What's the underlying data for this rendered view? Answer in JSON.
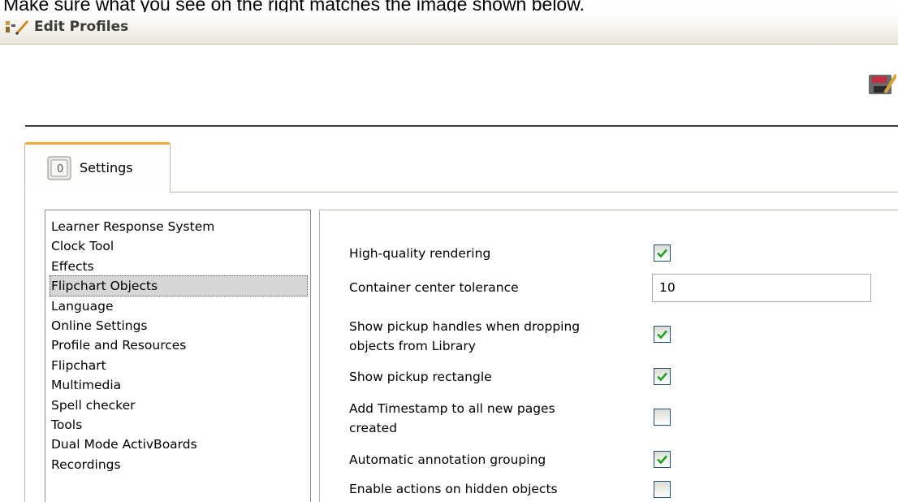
{
  "instruction": "Make sure what you see on the right matches the image shown below.",
  "window": {
    "title": "Edit Profiles"
  },
  "tabs": [
    {
      "label": "Settings"
    }
  ],
  "categories": [
    "Learner Response System",
    "Clock Tool",
    "Effects",
    "Flipchart Objects",
    "Language",
    "Online Settings",
    "Profile and Resources",
    "Flipchart",
    "Multimedia",
    "Spell checker",
    "Tools",
    "Dual Mode ActivBoards",
    "Recordings"
  ],
  "selected_category": "Flipchart Objects",
  "settings": {
    "high_quality_rendering": {
      "label": "High-quality rendering",
      "checked": true
    },
    "container_center_tolerance": {
      "label": "Container center tolerance",
      "value": "10"
    },
    "show_pickup_handles": {
      "label_line1": "Show pickup handles when dropping",
      "label_line2": "objects from Library",
      "checked": true
    },
    "show_pickup_rectangle": {
      "label": "Show pickup rectangle",
      "checked": true
    },
    "add_timestamp": {
      "label_line1": "Add Timestamp to all new pages",
      "label_line2": "created",
      "checked": false
    },
    "automatic_annotation_grouping": {
      "label": "Automatic annotation grouping",
      "checked": true
    },
    "enable_actions_hidden": {
      "label": "Enable actions on hidden objects",
      "checked": false
    }
  },
  "colors": {
    "tab_accent": "#f0a53a",
    "check_green": "#21a121",
    "checkbox_border": "#1c5180"
  },
  "icons": {
    "title": "edit-profile-icon",
    "toolbar": "profile-save-icon",
    "tab": "settings-icon"
  }
}
